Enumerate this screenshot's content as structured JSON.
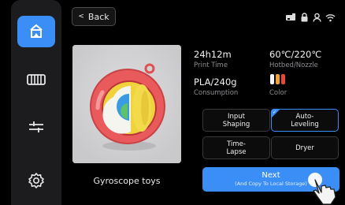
{
  "sidebar": {
    "items": [
      {
        "icon": "print-files-icon",
        "active": true
      },
      {
        "icon": "filament-spool-icon",
        "active": false
      },
      {
        "icon": "sliders-icon",
        "active": false
      },
      {
        "icon": "settings-gear-icon",
        "active": false
      }
    ]
  },
  "header": {
    "back_label": "Back",
    "status_icons": [
      "printer-status-icon",
      "lock-icon",
      "user-icon",
      "wifi-icon"
    ]
  },
  "preview": {
    "model_name": "Gyroscope toys"
  },
  "print_info": {
    "time_value": "24h12m",
    "time_label": "Print Time",
    "temp_value": "60℃/220℃",
    "temp_label": "Hotbed/Nozzle",
    "consumption_value": "PLA/240g",
    "consumption_label": "Consumption",
    "color_label": "Color",
    "colors": [
      "#f5f5f5",
      "#f2a03a",
      "#e8483b"
    ]
  },
  "options": {
    "input_shaping": "Input\nShaping",
    "auto_leveling": "Auto-\nLeveling",
    "time_lapse": "Time-\nLapse",
    "dryer": "Dryer",
    "selected": [
      "auto_leveling"
    ]
  },
  "next_button": {
    "label": "Next",
    "sublabel": "(And Copy To Local Storage)"
  },
  "accent_color": "#3a8ef5"
}
